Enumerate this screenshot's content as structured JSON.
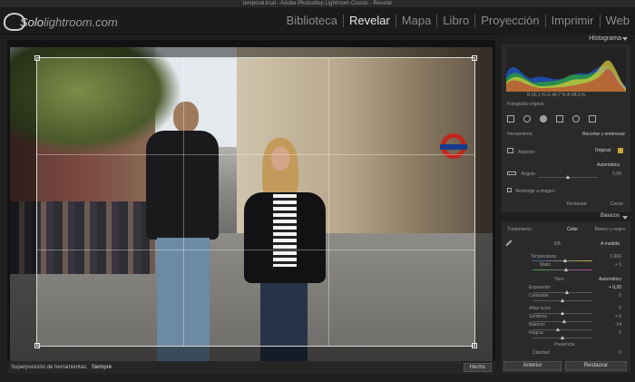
{
  "window_title": "temporal.lrcat - Adobe Photoshop Lightroom Classic - Revelar",
  "logo": {
    "brand": "Solo",
    "suffix": "lightroom.com"
  },
  "modules": [
    "Biblioteca",
    "Revelar",
    "Mapa",
    "Libro",
    "Proyección",
    "Imprimir",
    "Web"
  ],
  "active_module": "Revelar",
  "toolbar": {
    "overlay_label": "Superposición de herramientas:",
    "overlay_value": "Siempre",
    "done": "Hecho"
  },
  "histogram": {
    "title": "Histograma",
    "values": "R 50,1 % G 49,7 % B 48,3 %",
    "original_photo": "Fotografía original"
  },
  "crop": {
    "tool_label": "Herramienta",
    "tool_value": "Recortar y enderezar",
    "aspect_label": "Aspecto:",
    "aspect_value": "Original",
    "auto": "Automática",
    "angle_label": "Ángulo",
    "angle_value": "0,00",
    "restrict": "Restringir a imagen",
    "reset": "Restaurar",
    "close": "Cerrar"
  },
  "basic": {
    "title": "Básicos",
    "treatment_label": "Tratamiento:",
    "treatment_color": "Color",
    "treatment_bw": "Blanco y negro",
    "wb_label": "EB:",
    "wb_value": "A medida",
    "temperature_label": "Temperatura",
    "temperature_value": "5.600",
    "tint_label": "Matiz",
    "tint_value": "+ 6",
    "tone_label": "Tono",
    "tone_auto": "Automático",
    "exposure_label": "Exposición",
    "exposure_value": "+ 0,20",
    "contrast_label": "Contraste",
    "contrast_value": "0",
    "highlights_label": "Altas luces",
    "highlights_value": "0",
    "shadows_label": "Sombras",
    "shadows_value": "+ 5",
    "whites_label": "Blancos",
    "whites_value": "- 14",
    "blacks_label": "Negros",
    "blacks_value": "0",
    "presence_label": "Presencia",
    "clarity_label": "Claridad",
    "clarity_value": "0"
  },
  "buttons": {
    "previous": "Anterior",
    "reset": "Restaurar"
  }
}
